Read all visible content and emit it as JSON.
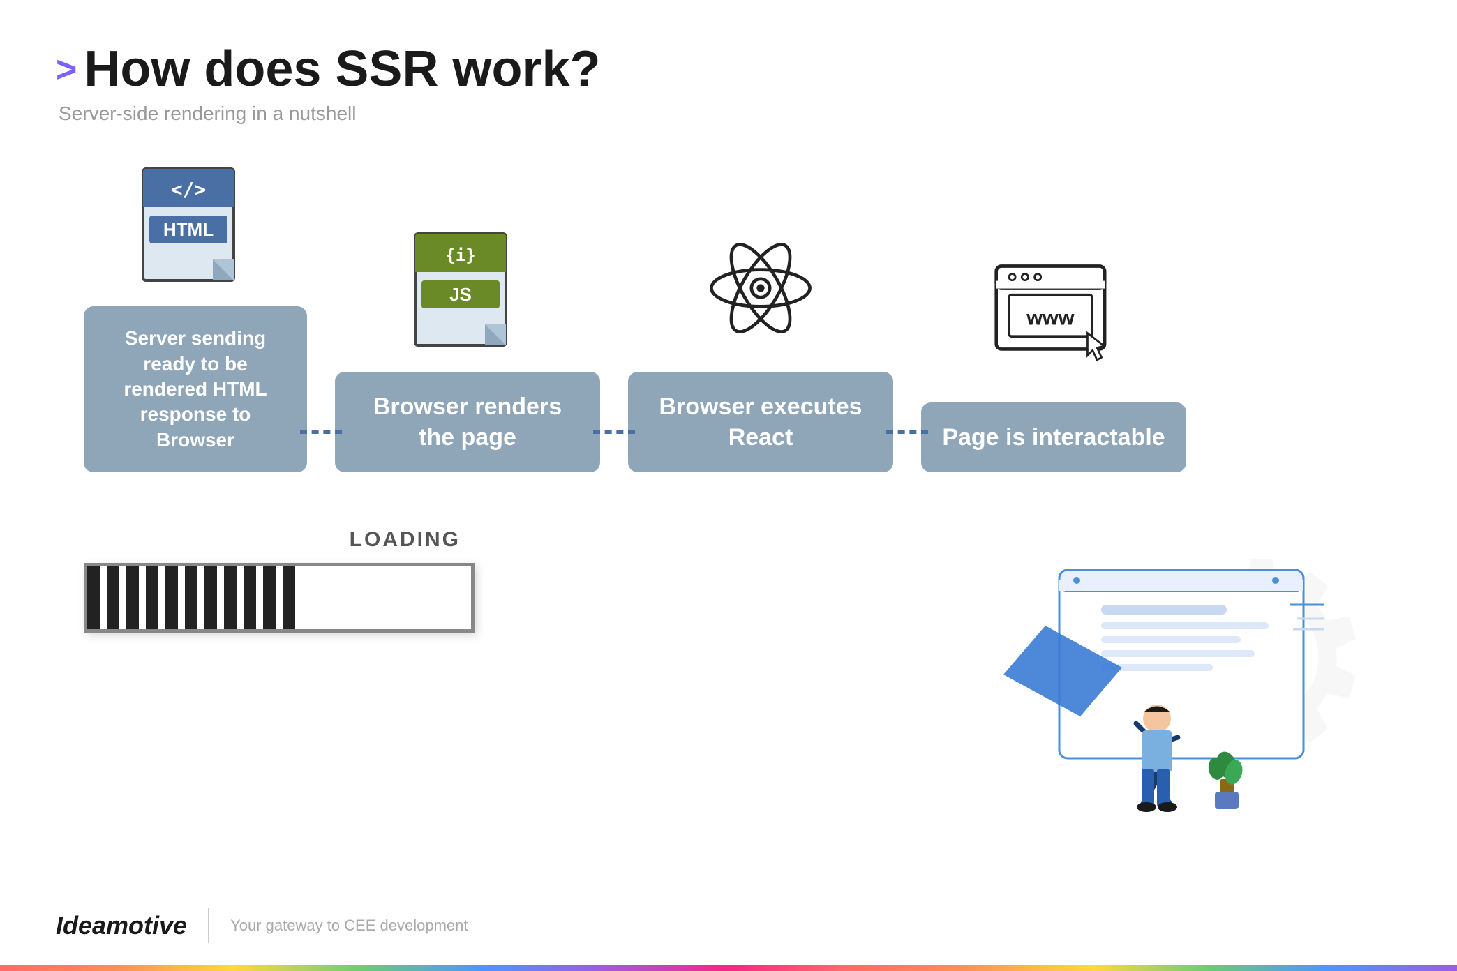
{
  "header": {
    "title": "How does SSR work?",
    "subtitle": "Server-side rendering in a nutshell",
    "title_arrow": ">"
  },
  "flow": {
    "steps": [
      {
        "icon_type": "html",
        "box_text": "Server sending ready to be rendered HTML response to Browser",
        "box_width": "wide"
      },
      {
        "icon_type": "js",
        "box_text": "Browser renders the page",
        "box_width": "narrow"
      },
      {
        "icon_type": "react",
        "box_text": "Browser executes React",
        "box_width": "narrow"
      },
      {
        "icon_type": "browser",
        "box_text": "Page is interactable",
        "box_width": "narrow"
      }
    ]
  },
  "loading": {
    "label": "LOADING"
  },
  "footer": {
    "logo": "Ideamotive",
    "tagline": "Your gateway to CEE development"
  }
}
